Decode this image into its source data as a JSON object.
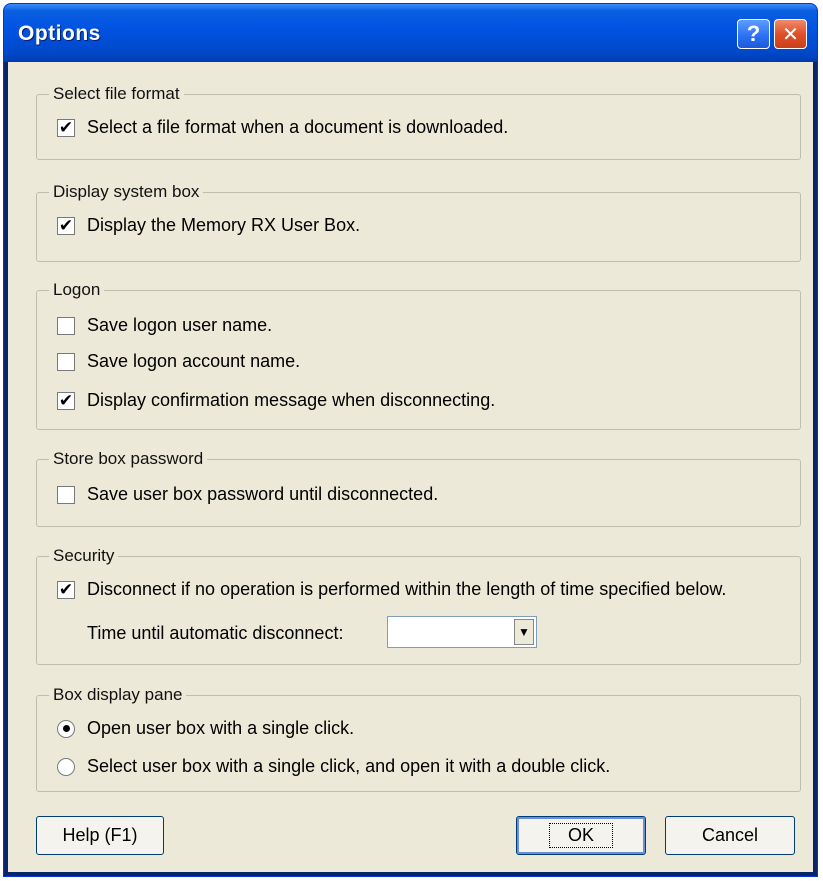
{
  "window": {
    "title": "Options"
  },
  "titlebar": {
    "help_glyph": "?",
    "close_glyph": "✕"
  },
  "groups": {
    "file_format": {
      "title": "Select file format",
      "options": [
        {
          "label": "Select a file format when a document is downloaded.",
          "checked": true
        }
      ]
    },
    "system_box": {
      "title": "Display system box",
      "options": [
        {
          "label": "Display the Memory RX User Box.",
          "checked": true
        }
      ]
    },
    "logon": {
      "title": "Logon",
      "options": [
        {
          "label": "Save logon user name.",
          "checked": false
        },
        {
          "label": "Save logon account name.",
          "checked": false
        },
        {
          "label": "Display confirmation message when disconnecting.",
          "checked": true
        }
      ]
    },
    "store_password": {
      "title": "Store box password",
      "options": [
        {
          "label": "Save user box password until disconnected.",
          "checked": false
        }
      ]
    },
    "security": {
      "title": "Security",
      "options": [
        {
          "label": "Disconnect if no operation is performed within the length of time specified below.",
          "checked": true
        }
      ],
      "timeout_label": "Time until automatic disconnect:",
      "timeout_value": ""
    },
    "box_pane": {
      "title": "Box display pane",
      "options": [
        {
          "label": "Open user box with a single click.",
          "selected": true
        },
        {
          "label": "Select user box with a single click, and open it with a double click.",
          "selected": false
        }
      ]
    }
  },
  "buttons": {
    "help": "Help (F1)",
    "ok": "OK",
    "cancel": "Cancel"
  },
  "glyphs": {
    "check": "✔",
    "dropdown_arrow": "▼"
  }
}
